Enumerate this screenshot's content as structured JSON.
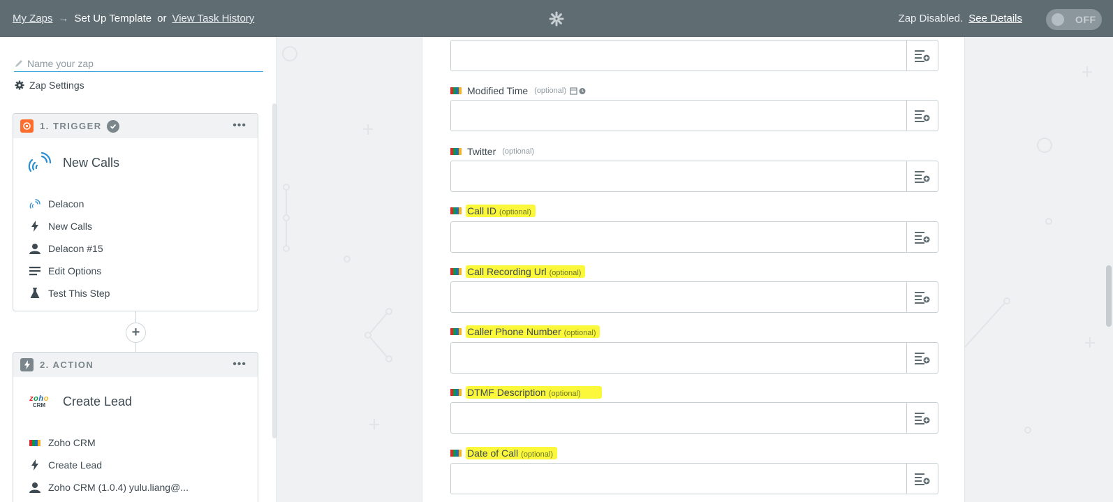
{
  "topbar": {
    "my_zaps": "My Zaps",
    "arrow": "→",
    "setup_template": "Set Up Template",
    "or": "or",
    "view_task_history": "View Task History",
    "zap_disabled": "Zap Disabled.",
    "see_details": "See Details",
    "toggle_label": "OFF"
  },
  "sidebar": {
    "name_placeholder": "Name your zap",
    "zap_settings": "Zap Settings",
    "trigger": {
      "title": "1. TRIGGER",
      "menu": "•••",
      "app_event": "New Calls",
      "items": [
        {
          "icon": "delacon-icon",
          "label": "Delacon"
        },
        {
          "icon": "bolt-icon",
          "label": "New Calls"
        },
        {
          "icon": "user-icon",
          "label": "Delacon #15"
        },
        {
          "icon": "options-icon",
          "label": "Edit Options"
        },
        {
          "icon": "flask-icon",
          "label": "Test This Step"
        }
      ]
    },
    "action": {
      "title": "2. ACTION",
      "menu": "•••",
      "app_event": "Create Lead",
      "logo_text_top": "zoho",
      "logo_text_bottom": "CRM",
      "items": [
        {
          "icon": "zoho-icon",
          "label": "Zoho CRM"
        },
        {
          "icon": "bolt-icon",
          "label": "Create Lead"
        },
        {
          "icon": "user-icon",
          "label": "Zoho CRM (1.0.4) yulu.liang@..."
        }
      ]
    }
  },
  "fields": [
    {
      "label": "",
      "optional": "",
      "highlight": false
    },
    {
      "label": "Modified Time",
      "optional": "(optional)",
      "highlight": false,
      "datetime": true
    },
    {
      "label": "Twitter",
      "optional": "(optional)",
      "highlight": false
    },
    {
      "label": "Call ID",
      "optional": "(optional)",
      "highlight": true
    },
    {
      "label": "Call Recording Url",
      "optional": "(optional)",
      "highlight": true
    },
    {
      "label": "Caller Phone Number",
      "optional": "(optional)",
      "highlight": true
    },
    {
      "label": "DTMF Description",
      "optional": "(optional)",
      "highlight": true
    },
    {
      "label": "Date of Call",
      "optional": "(optional)",
      "highlight": true
    }
  ],
  "colors": {
    "topbar": "#5f6c72",
    "highlight": "#fbf73a",
    "trigger_badge": "#ff6d2d",
    "action_badge": "#7a868c",
    "link_blue": "#3fa5d7"
  }
}
